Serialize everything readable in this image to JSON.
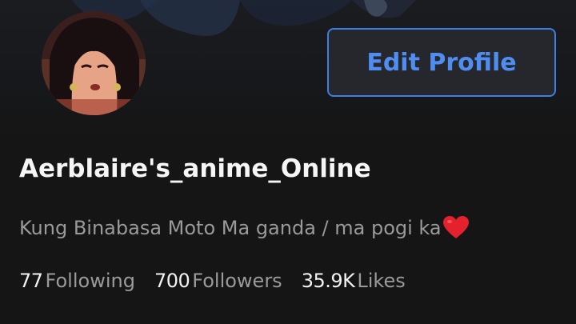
{
  "profile": {
    "edit_button_label": "Edit Profile",
    "username": "Aerblaire's_anime_Online",
    "bio_text": "Kung Binabasa Moto Ma ganda / ma pogi ka",
    "bio_emoji": "heart-emoji"
  },
  "stats": [
    {
      "value": "77",
      "label": "Following"
    },
    {
      "value": "700",
      "label": "Followers"
    },
    {
      "value": "35.9K",
      "label": "Likes"
    }
  ],
  "colors": {
    "background": "#151515",
    "accent": "#4f8ef0",
    "button_border": "#3d7fe0",
    "text_primary": "#f5f5f5",
    "text_secondary": "#9a9a9a",
    "heart": "#e5212d"
  },
  "icons": {
    "avatar": "anime-character-avatar",
    "heart": "heart-icon"
  }
}
